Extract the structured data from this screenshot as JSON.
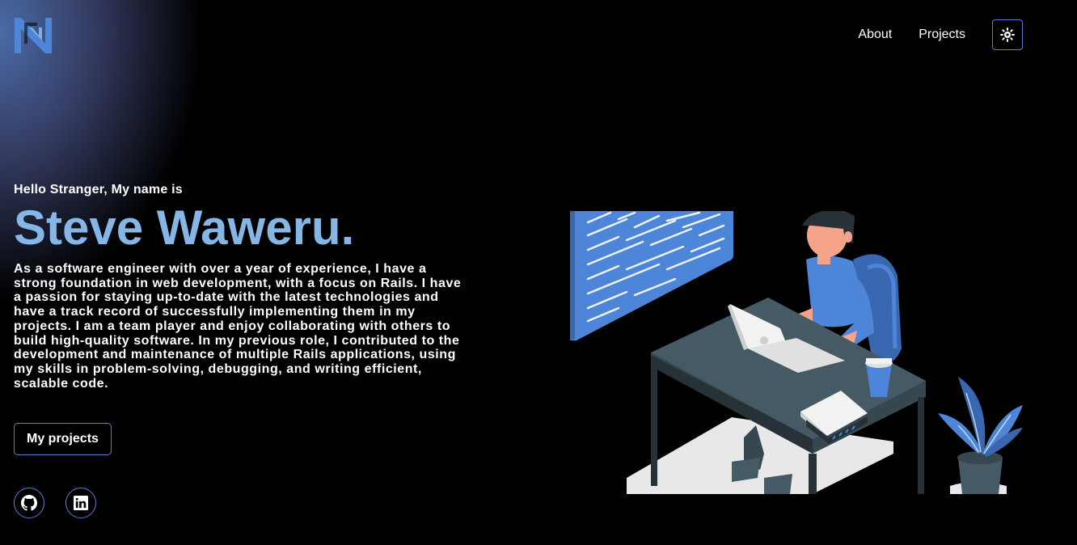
{
  "nav": {
    "links": [
      "About",
      "Projects"
    ],
    "theme_toggle_icon": "sun-icon"
  },
  "logo": {
    "icon": "n-monogram-logo"
  },
  "hero": {
    "greeting": "Hello Stranger, My name is",
    "name": "Steve Waweru.",
    "bio": "As a software engineer with over a year of experience, I have a strong foundation in web development, with a focus on Rails. I have a passion for staying up-to-date with the latest technologies and have a track record of successfully implementing them in my projects. I am a team player and enjoy collaborating with others to build high-quality software. In my previous role, I contributed to the development and maintenance of multiple Rails applications, using my skills in problem-solving, debugging, and writing efficient, scalable code.",
    "cta_label": "My projects"
  },
  "social": [
    "github-icon",
    "linkedin-icon"
  ],
  "colors": {
    "accent": "#86b6e6",
    "border": "#5a7fd0",
    "background": "#000000",
    "illustration_blue": "#4d86d8"
  }
}
